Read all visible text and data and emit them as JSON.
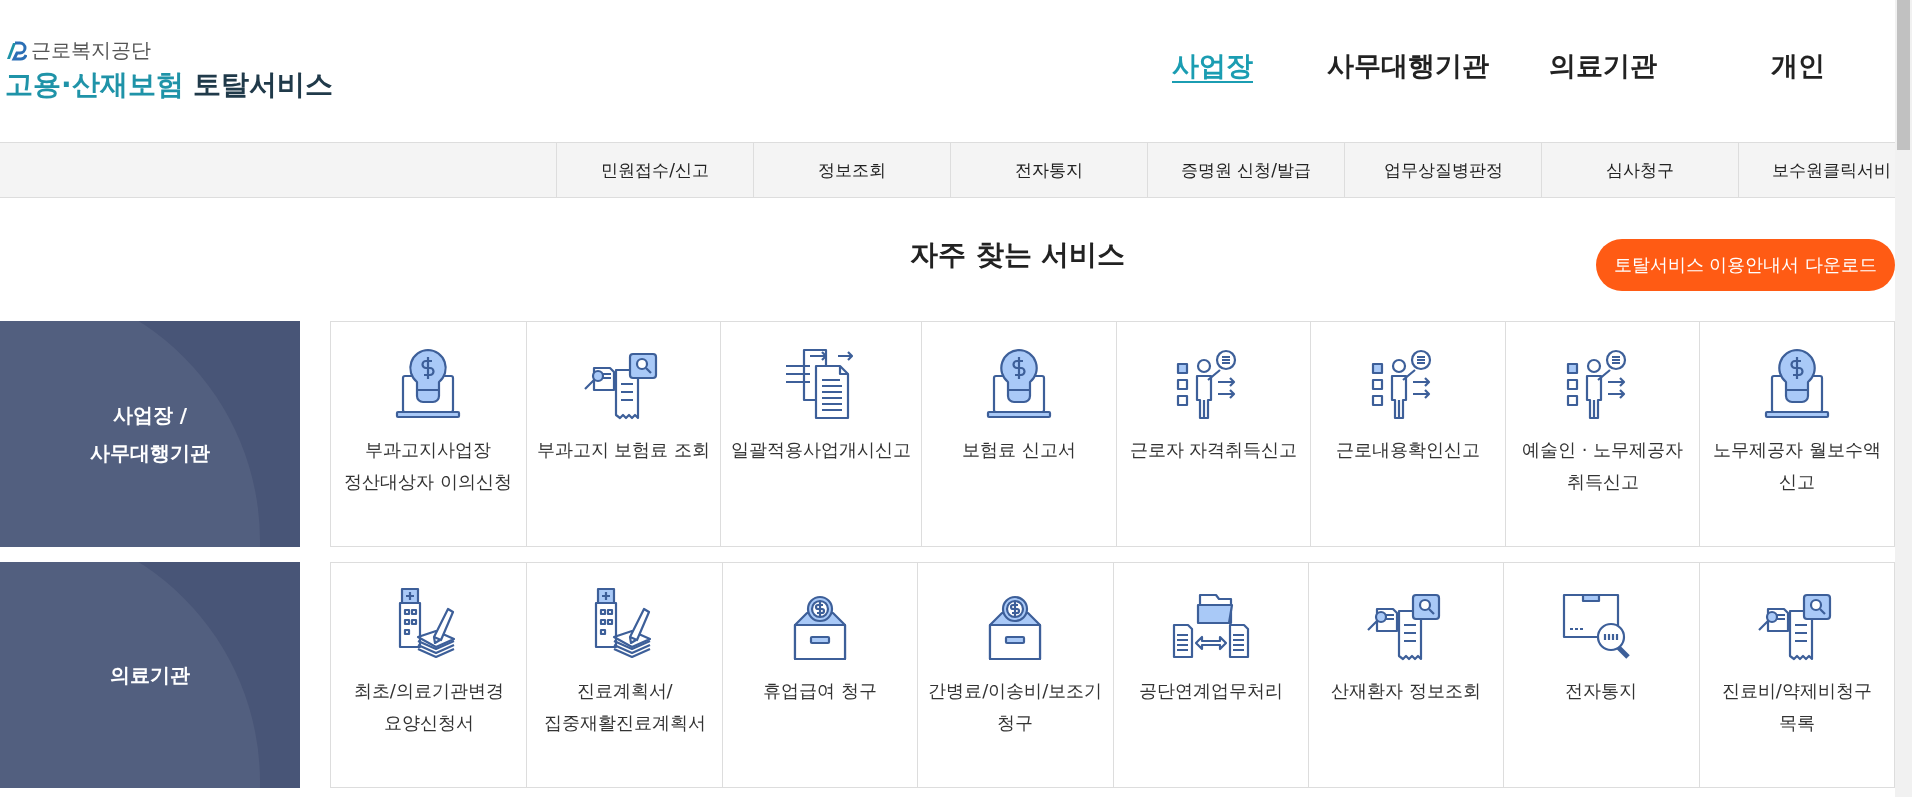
{
  "logo": {
    "org": "근로복지공단",
    "service_accent": "고용·산재보험",
    "service_name": "토탈서비스"
  },
  "main_nav": [
    {
      "label": "사업장",
      "selected": true
    },
    {
      "label": "사무대행기관",
      "selected": false
    },
    {
      "label": "의료기관",
      "selected": false
    },
    {
      "label": "개인",
      "selected": false
    }
  ],
  "sub_nav": [
    "민원접수/신고",
    "정보조회",
    "전자통지",
    "증명원 신청/발급",
    "업무상질병판정",
    "심사청구",
    "보수원클릭서비"
  ],
  "section_title": "자주 찾는 서비스",
  "download_button": "토탈서비스 이용안내서 다운로드",
  "service_groups": [
    {
      "title": "사업장 /\n사무대행기관",
      "items": [
        "부과고지사업장 정산대상자 이의신청",
        "부과고지 보험료 조회",
        "일괄적용사업개시신고",
        "보험료 신고서",
        "근로자 자격취득신고",
        "근로내용확인신고",
        "예술인 · 노무제공자 취득신고",
        "노무제공자 월보수액 신고"
      ]
    },
    {
      "title": "의료기관",
      "items": [
        "최초/의료기관변경 요양신청서",
        "진료계획서/집중재활진료계획서",
        "휴업급여 청구",
        "간병료/이송비/보조기 청구",
        "공단연계업무처리",
        "산재환자 정보조회",
        "전자통지",
        "진료비/약제비청구 목록"
      ]
    }
  ]
}
